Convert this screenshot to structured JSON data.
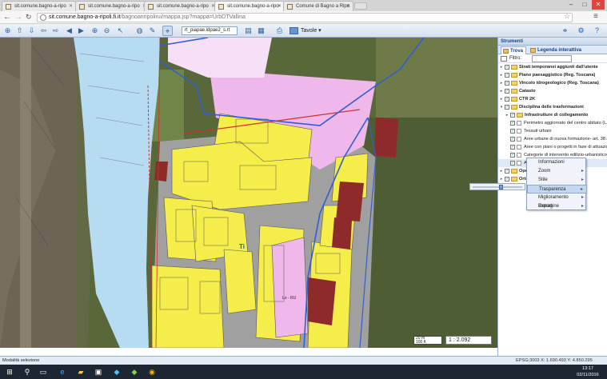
{
  "browser": {
    "tabs": [
      {
        "label": "sit.comune.bagno-a-ripo"
      },
      {
        "label": "sit.comune.bagno-a-ripo"
      },
      {
        "label": "sit.comune.bagno-a-ripo"
      },
      {
        "label": "sit.comune.bagno-a-ripo"
      },
      {
        "label": "Comune di Bagno a Ripo"
      }
    ],
    "url_domain": "sit.comune.bagno-a-ripoli.fi.it",
    "url_path": "/bagnoanripolirui/mappa.jsp?mappa=UrbDTVallina",
    "window_controls": {
      "minimize": "–",
      "maximize": "□",
      "close": "✕"
    }
  },
  "toolbar": {
    "layer_select_value": "rt_piapae.idpae2_s.rt",
    "tavole_label": "Tavole"
  },
  "map": {
    "scale_box_text": "20 m\n100 ft",
    "scale_value": "1 : 2.092",
    "labels": [
      "Ti",
      "Lo - RU"
    ]
  },
  "panel": {
    "title": "Strumenti",
    "tabs": [
      {
        "label": "Trova"
      },
      {
        "label": "Legenda interattiva"
      }
    ],
    "filter_label": "Filtro:",
    "tree": [
      {
        "label": "Strati temporanei aggiunti dall'utente",
        "bold": true,
        "level": 0
      },
      {
        "label": "Piano paesaggistico (Reg. Toscana)",
        "bold": true,
        "level": 0
      },
      {
        "label": "Vincolo idrogeologico (Reg. Toscana)",
        "bold": true,
        "level": 0
      },
      {
        "label": "Catasto",
        "bold": true,
        "level": 0
      },
      {
        "label": "CTR 2K",
        "bold": true,
        "level": 0
      },
      {
        "label": "Disciplina delle trasformazioni",
        "bold": true,
        "level": 0
      },
      {
        "label": "Infrastrutture di collegamento",
        "bold": true,
        "level": 1
      },
      {
        "label": "Perimetro aggiornato del centro abitato (L.R. 1)",
        "bold": false,
        "level": 1
      },
      {
        "label": "Tessuti urbani",
        "bold": false,
        "level": 1
      },
      {
        "label": "Aree urbane di nuova formazione- art. 38 punto",
        "bold": false,
        "level": 1
      },
      {
        "label": "Aree con piani o progetti in fase di attuazione -",
        "bold": false,
        "level": 1
      },
      {
        "label": "Categorie di intervento edilizio-urbanistico - art",
        "bold": false,
        "level": 1
      },
      {
        "label": "A",
        "bold": false,
        "level": 1
      },
      {
        "label": "Oper",
        "bold": true,
        "level": 0
      },
      {
        "label": "Ortof",
        "bold": true,
        "level": 0
      }
    ]
  },
  "context_menu": {
    "items": [
      {
        "label": "Informazioni",
        "submenu": false
      },
      {
        "label": "Zoom",
        "submenu": true
      },
      {
        "label": "Stile",
        "submenu": true
      },
      {
        "label": "Trasparenza",
        "submenu": true
      },
      {
        "label": "Miglioramento immagine",
        "submenu": true
      },
      {
        "label": "Export",
        "submenu": true
      }
    ],
    "highlighted": "Trasparenza"
  },
  "status": {
    "mode": "Modalità selezione",
    "projection": "EPSG:3003  X: 1.690.493  Y: 4.850.295"
  },
  "taskbar": {
    "time": "13:17",
    "date": "02/11/2016"
  },
  "colors": {
    "yellow_zone": "#f5ee4a",
    "pink_zone": "#f0b8ea",
    "red_zone": "#8e2a2a",
    "river": "#b7dcf2",
    "blue_boundary": "#2f5fd0"
  }
}
